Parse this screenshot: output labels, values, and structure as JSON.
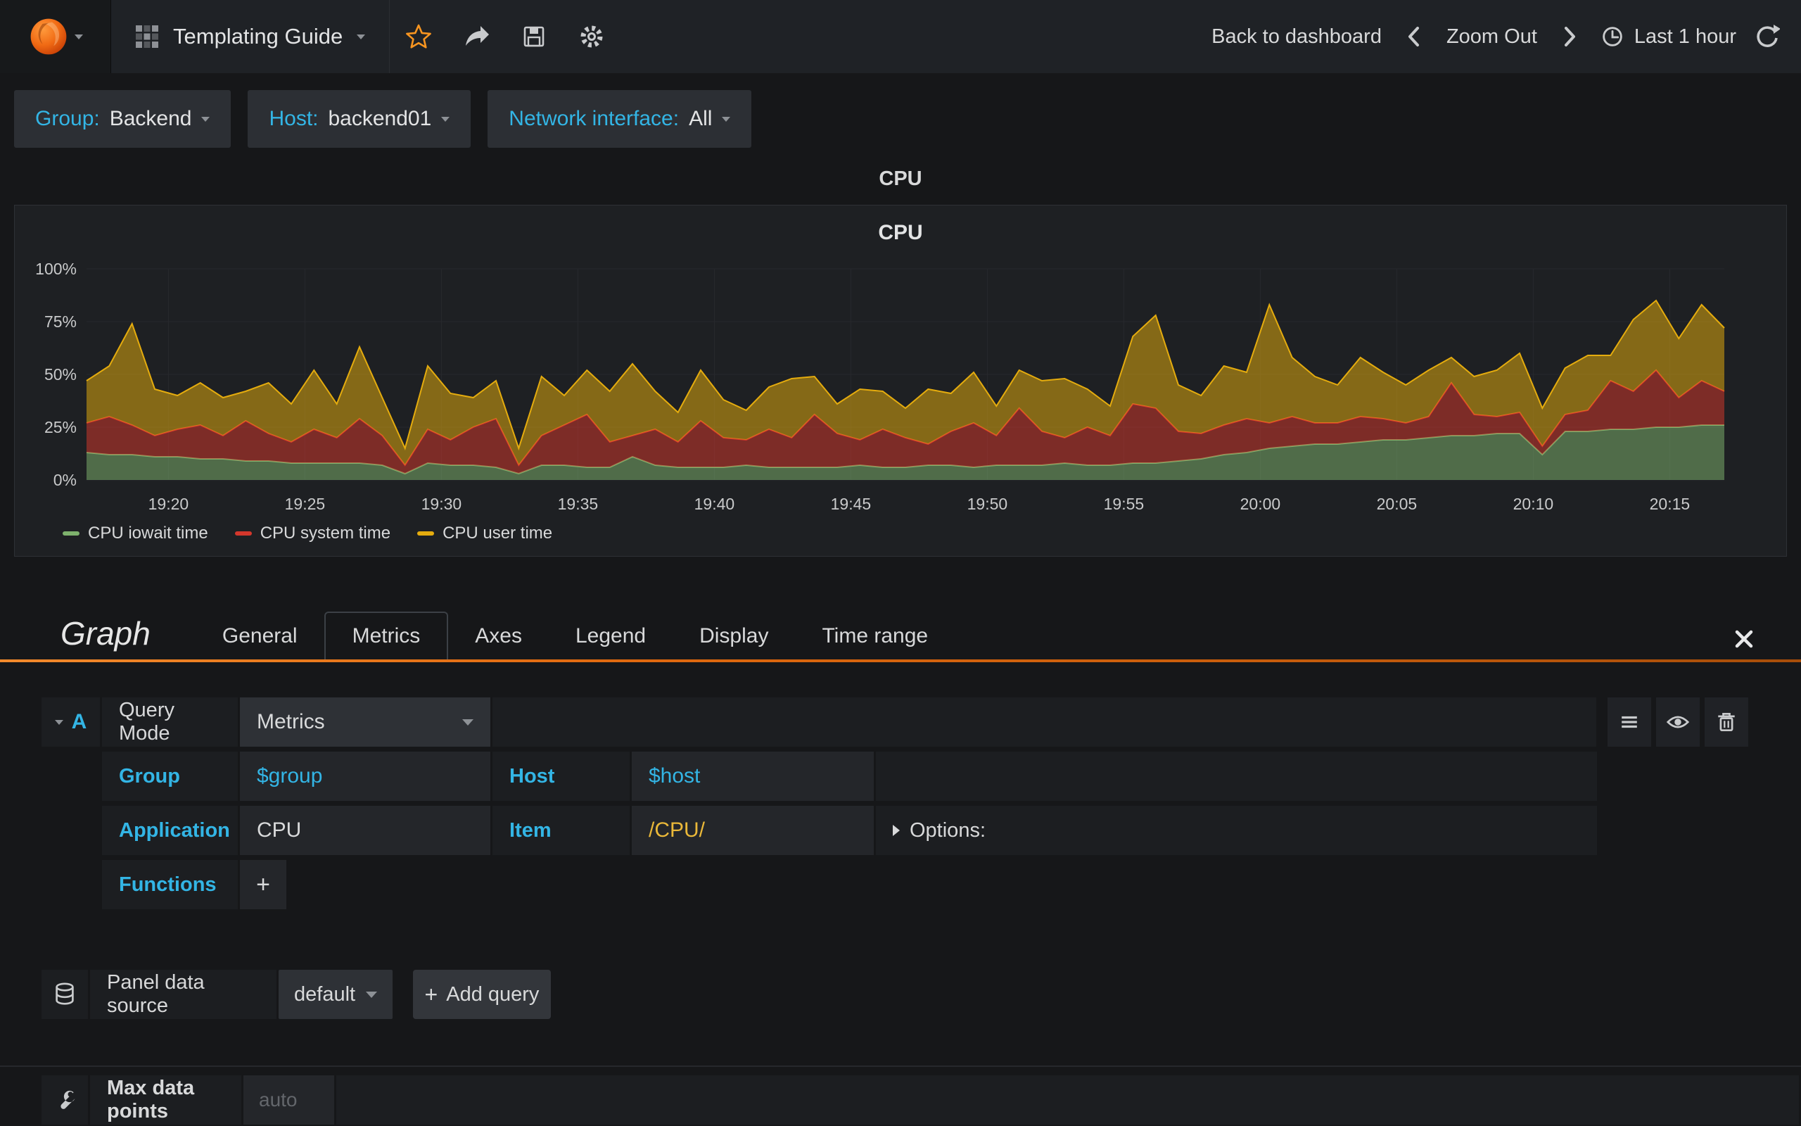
{
  "navbar": {
    "title": "Templating Guide",
    "back": "Back to dashboard",
    "zoom_out": "Zoom Out",
    "time_range": "Last 1 hour"
  },
  "template_vars": [
    {
      "label": "Group:",
      "value": "Backend"
    },
    {
      "label": "Host:",
      "value": "backend01"
    },
    {
      "label": "Network interface:",
      "value": "All"
    }
  ],
  "panel": {
    "header": "CPU"
  },
  "chart_data": {
    "type": "area",
    "stacked": true,
    "title": "CPU",
    "ylim": [
      0,
      100
    ],
    "y_tick_labels": [
      "0%",
      "25%",
      "50%",
      "75%",
      "100%"
    ],
    "x_tick_labels": [
      "19:20",
      "19:25",
      "19:30",
      "19:35",
      "19:40",
      "19:45",
      "19:50",
      "19:55",
      "20:00",
      "20:05",
      "20:10",
      "20:15"
    ],
    "x_domain_minutes": 60,
    "x_first_tick_offset_minutes": 3,
    "x_tick_interval_minutes": 5,
    "grid": true,
    "legend_position": "bottom-left",
    "series": [
      {
        "name": "CPU iowait time",
        "color": "#7eb26d",
        "values": [
          13,
          12,
          12,
          11,
          11,
          10,
          10,
          9,
          9,
          8,
          8,
          8,
          8,
          7,
          3,
          8,
          7,
          7,
          6,
          3,
          7,
          7,
          6,
          6,
          11,
          7,
          6,
          6,
          6,
          7,
          6,
          6,
          6,
          6,
          7,
          6,
          6,
          7,
          7,
          6,
          7,
          7,
          7,
          8,
          7,
          7,
          8,
          8,
          9,
          10,
          12,
          13,
          15,
          16,
          17,
          17,
          18,
          19,
          19,
          20,
          21,
          21,
          22,
          22,
          12,
          23,
          23,
          24,
          24,
          25,
          25,
          26,
          26
        ]
      },
      {
        "name": "CPU system time",
        "color": "#d4372c",
        "values": [
          14,
          18,
          14,
          10,
          13,
          16,
          11,
          19,
          13,
          10,
          16,
          12,
          21,
          14,
          4,
          16,
          12,
          18,
          23,
          4,
          14,
          19,
          25,
          12,
          10,
          17,
          12,
          22,
          14,
          12,
          18,
          14,
          25,
          16,
          12,
          18,
          14,
          10,
          16,
          21,
          14,
          27,
          16,
          12,
          18,
          14,
          28,
          26,
          14,
          12,
          14,
          16,
          12,
          14,
          10,
          10,
          12,
          10,
          8,
          10,
          25,
          10,
          8,
          10,
          4,
          8,
          10,
          23,
          18,
          27,
          14,
          21,
          16
        ]
      },
      {
        "name": "CPU user time",
        "color": "#e5ac0e",
        "values": [
          20,
          24,
          48,
          22,
          16,
          20,
          18,
          14,
          24,
          18,
          28,
          16,
          34,
          18,
          8,
          30,
          22,
          14,
          18,
          8,
          28,
          14,
          21,
          24,
          34,
          18,
          14,
          24,
          18,
          14,
          20,
          28,
          18,
          14,
          24,
          18,
          14,
          26,
          18,
          24,
          14,
          18,
          24,
          28,
          18,
          14,
          32,
          44,
          22,
          18,
          28,
          22,
          56,
          28,
          22,
          18,
          28,
          22,
          18,
          22,
          12,
          18,
          22,
          28,
          18,
          22,
          26,
          12,
          34,
          33,
          28,
          36,
          30
        ]
      }
    ]
  },
  "editor": {
    "panel_type": "Graph",
    "tabs": [
      "General",
      "Metrics",
      "Axes",
      "Legend",
      "Display",
      "Time range"
    ],
    "active_tab": "Metrics",
    "query": {
      "letter": "A",
      "mode_label": "Query Mode",
      "mode_value": "Metrics",
      "group_label": "Group",
      "group_value": "$group",
      "host_label": "Host",
      "host_value": "$host",
      "app_label": "Application",
      "app_value": "CPU",
      "item_label": "Item",
      "item_value": "/CPU/",
      "options_label": "Options:",
      "functions_label": "Functions",
      "add_function_label": "+"
    },
    "datasource": {
      "label": "Panel data source",
      "value": "default",
      "plus": "+",
      "add_query_label": "Add query"
    },
    "max_data_points": {
      "label": "Max data points",
      "placeholder": "auto"
    }
  }
}
